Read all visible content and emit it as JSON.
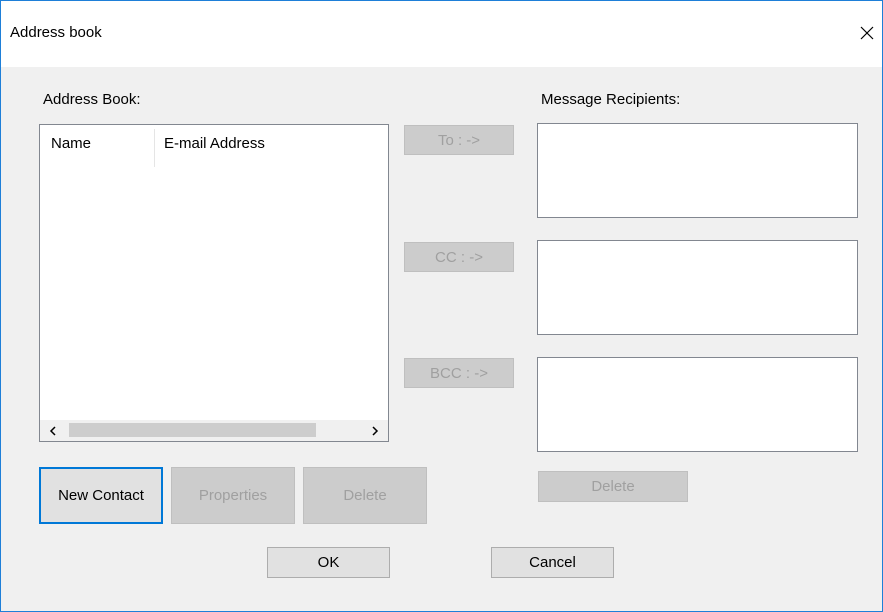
{
  "window": {
    "title": "Address book"
  },
  "address_book": {
    "label": "Address Book:",
    "columns": [
      "Name",
      "E-mail Address"
    ]
  },
  "recipients": {
    "label": "Message Recipients:"
  },
  "buttons": {
    "to": "To : ->",
    "cc": "CC : ->",
    "bcc": "BCC : ->",
    "new_contact": "New Contact",
    "properties": "Properties",
    "delete_contact": "Delete",
    "delete_recipient": "Delete",
    "ok": "OK",
    "cancel": "Cancel"
  },
  "icons": {
    "close": "close-icon",
    "scroll_left": "chevron-left-icon",
    "scroll_right": "chevron-right-icon"
  }
}
